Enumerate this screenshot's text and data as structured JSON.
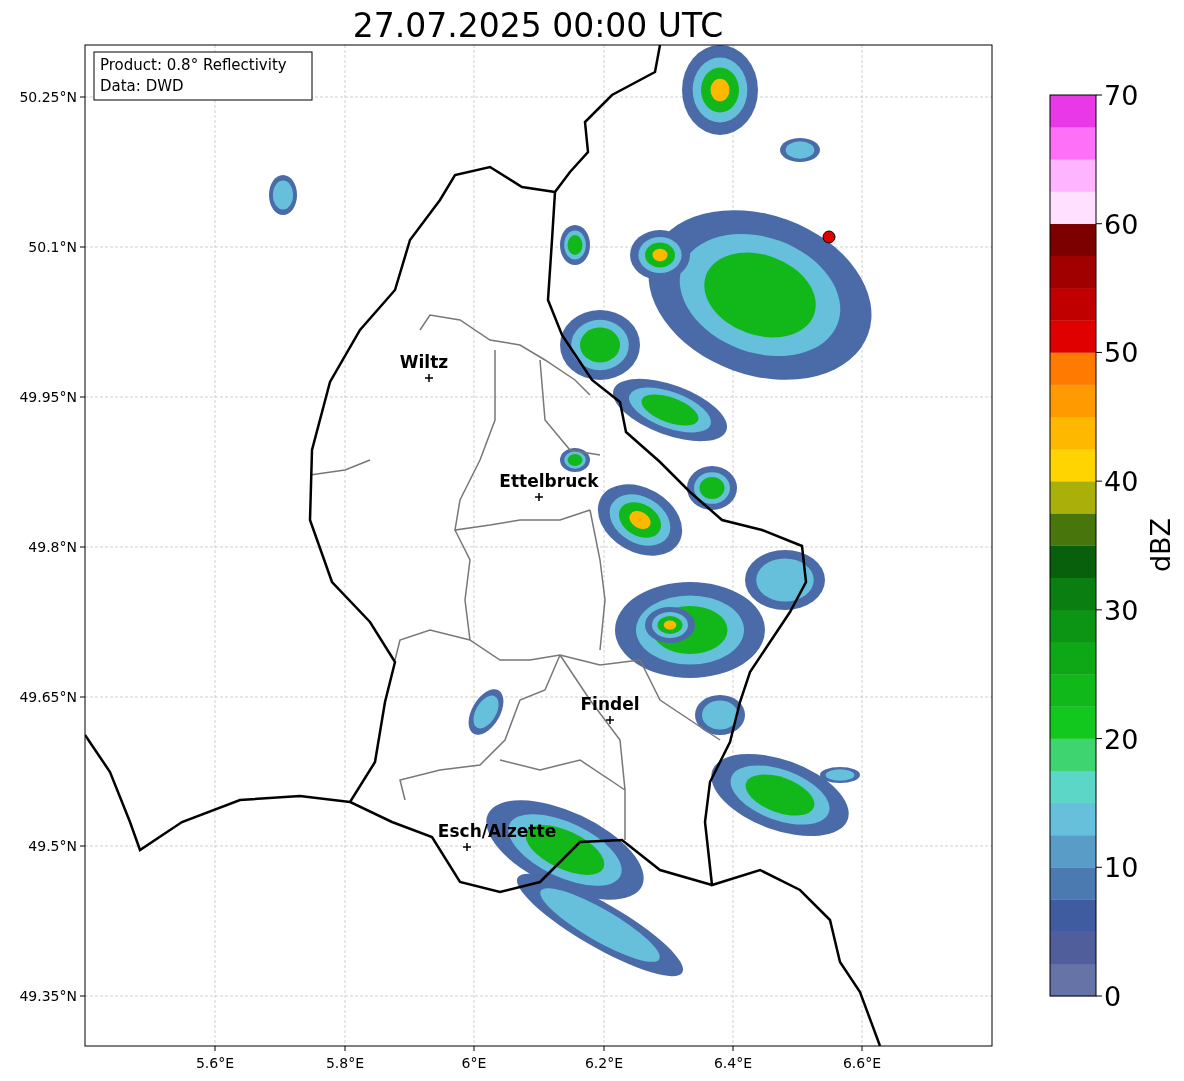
{
  "title": "27.07.2025 00:00 UTC",
  "info_box": {
    "lines": [
      "Product: 0.8° Reflectivity",
      "Data: DWD"
    ]
  },
  "map": {
    "y_ticks": [
      "50.25°N",
      "50.1°N",
      "49.95°N",
      "49.8°N",
      "49.65°N",
      "49.5°N",
      "49.35°N"
    ],
    "x_ticks": [
      "5.6°E",
      "5.8°E",
      "6°E",
      "6.2°E",
      "6.4°E",
      "6.6°E"
    ],
    "places": [
      {
        "name": "Wiltz"
      },
      {
        "name": "Ettelbruck"
      },
      {
        "name": "Findel"
      },
      {
        "name": "Esch/Alzette"
      }
    ]
  },
  "colorbar": {
    "label": "dBZ",
    "ticks": [
      "70",
      "60",
      "50",
      "40",
      "30",
      "20",
      "10",
      "0"
    ],
    "bands": [
      {
        "color": "#6673a6"
      },
      {
        "color": "#505f9c"
      },
      {
        "color": "#3f5ca0"
      },
      {
        "color": "#4a7ab0"
      },
      {
        "color": "#5a9cc8"
      },
      {
        "color": "#66c0dc"
      },
      {
        "color": "#5cd6c6"
      },
      {
        "color": "#3ed470"
      },
      {
        "color": "#12c81e"
      },
      {
        "color": "#10b81a"
      },
      {
        "color": "#0ea816"
      },
      {
        "color": "#0c9414"
      },
      {
        "color": "#0a7e10"
      },
      {
        "color": "#08600c"
      },
      {
        "color": "#48760c"
      },
      {
        "color": "#aab00a"
      },
      {
        "color": "#ffd400"
      },
      {
        "color": "#ffb800"
      },
      {
        "color": "#ff9a00"
      },
      {
        "color": "#ff7a00"
      },
      {
        "color": "#e00000"
      },
      {
        "color": "#c00000"
      },
      {
        "color": "#a00000"
      },
      {
        "color": "#7c0000"
      },
      {
        "color": "#ffe0ff"
      },
      {
        "color": "#ffb4ff"
      },
      {
        "color": "#ff70f8"
      },
      {
        "color": "#e838e8"
      }
    ]
  }
}
